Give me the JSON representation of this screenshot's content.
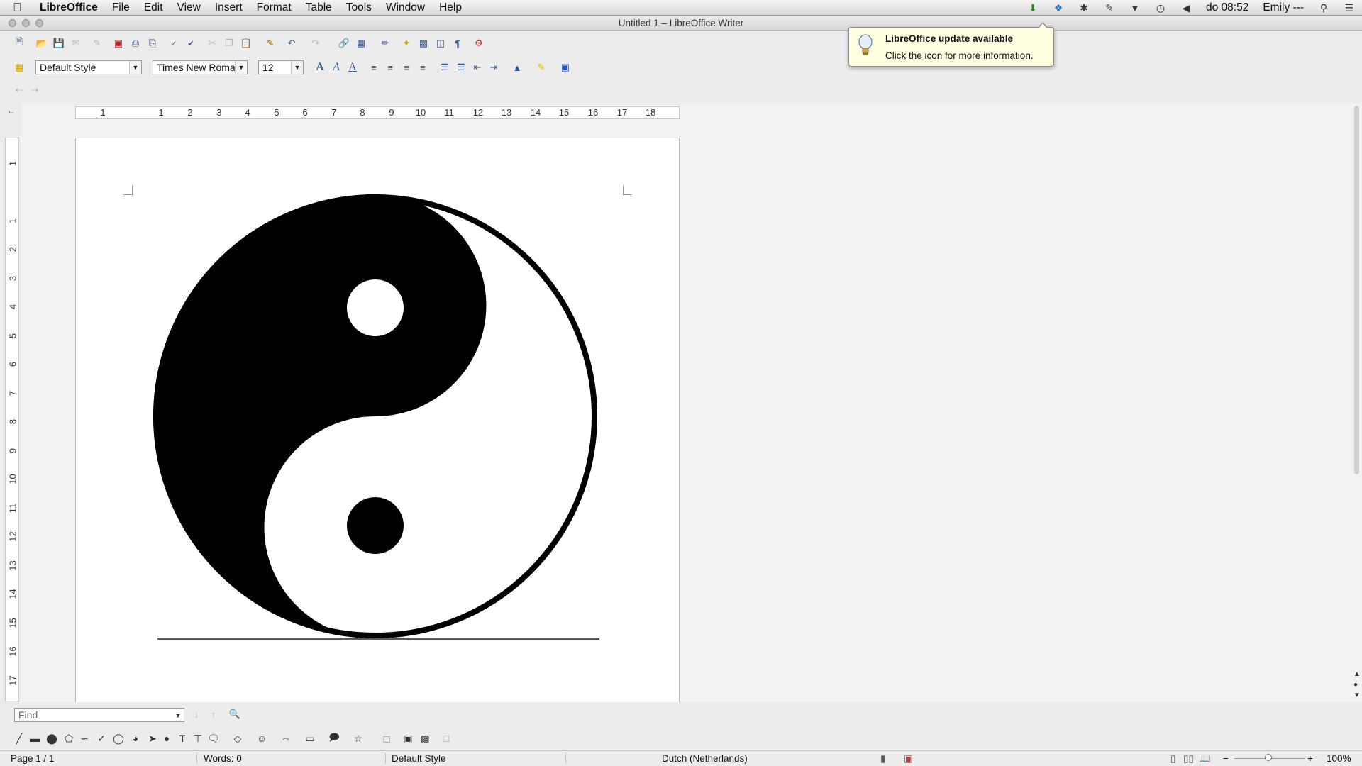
{
  "menubar": {
    "apple_icon": "apple-icon",
    "items": [
      "LibreOffice",
      "File",
      "Edit",
      "View",
      "Insert",
      "Format",
      "Table",
      "Tools",
      "Window",
      "Help"
    ],
    "clock": "do 08:52",
    "user": "Emily ---"
  },
  "window": {
    "title": "Untitled 1 – LibreOffice Writer"
  },
  "formatting": {
    "paragraph_style": "Default Style",
    "font_name": "Times New Roma",
    "font_size": "12"
  },
  "find": {
    "placeholder": "Find"
  },
  "hruler": {
    "labels": [
      "1",
      "1",
      "2",
      "3",
      "4",
      "5",
      "6",
      "7",
      "8",
      "9",
      "10",
      "11",
      "12",
      "13",
      "14",
      "15",
      "16",
      "17",
      "18"
    ]
  },
  "vruler": {
    "labels": [
      "1",
      "1",
      "2",
      "3",
      "4",
      "5",
      "6",
      "7",
      "8",
      "9",
      "10",
      "11",
      "12",
      "13",
      "14",
      "15",
      "16",
      "17"
    ]
  },
  "statusbar": {
    "page": "Page 1 / 1",
    "words": "Words: 0",
    "style": "Default Style",
    "language": "Dutch (Netherlands)",
    "zoom": "100%"
  },
  "tooltip": {
    "title": "LibreOffice update available",
    "body": "Click the icon for more information."
  },
  "colors": {
    "tooltip_bg": "#ffffe1",
    "page_bg": "#ffffff",
    "chrome_bg": "#ececec"
  }
}
